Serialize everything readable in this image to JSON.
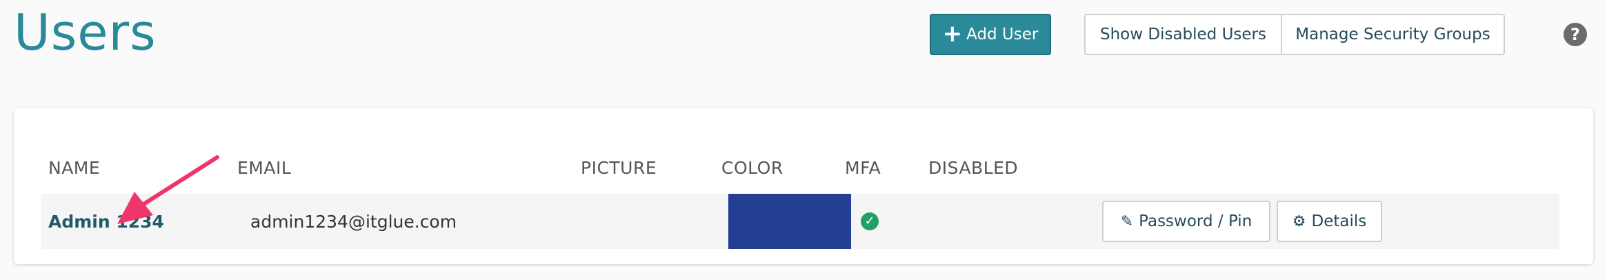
{
  "page": {
    "title": "Users"
  },
  "toolbar": {
    "add_user_label": "Add User",
    "add_user_icon": "plus-icon",
    "show_disabled_label": "Show Disabled Users",
    "manage_groups_label": "Manage Security Groups",
    "help_icon": "question-circle-icon"
  },
  "table": {
    "columns": {
      "name": "NAME",
      "email": "EMAIL",
      "picture": "PICTURE",
      "color": "COLOR",
      "mfa": "MFA",
      "disabled": "DISABLED"
    },
    "rows": [
      {
        "name": "Admin 1234",
        "email": "admin1234@itglue.com",
        "picture": "",
        "color": "#233f94",
        "mfa": "enabled",
        "mfa_icon": "check-circle-icon",
        "disabled": "",
        "password_label": "Password / Pin",
        "password_icon": "pencil-icon",
        "details_label": "Details",
        "details_icon": "gear-icon"
      }
    ]
  },
  "colors": {
    "accent": "#2a8a99",
    "link": "#1f5a6a",
    "annotation_arrow": "#f0356b",
    "mfa_check": "#21a061"
  }
}
